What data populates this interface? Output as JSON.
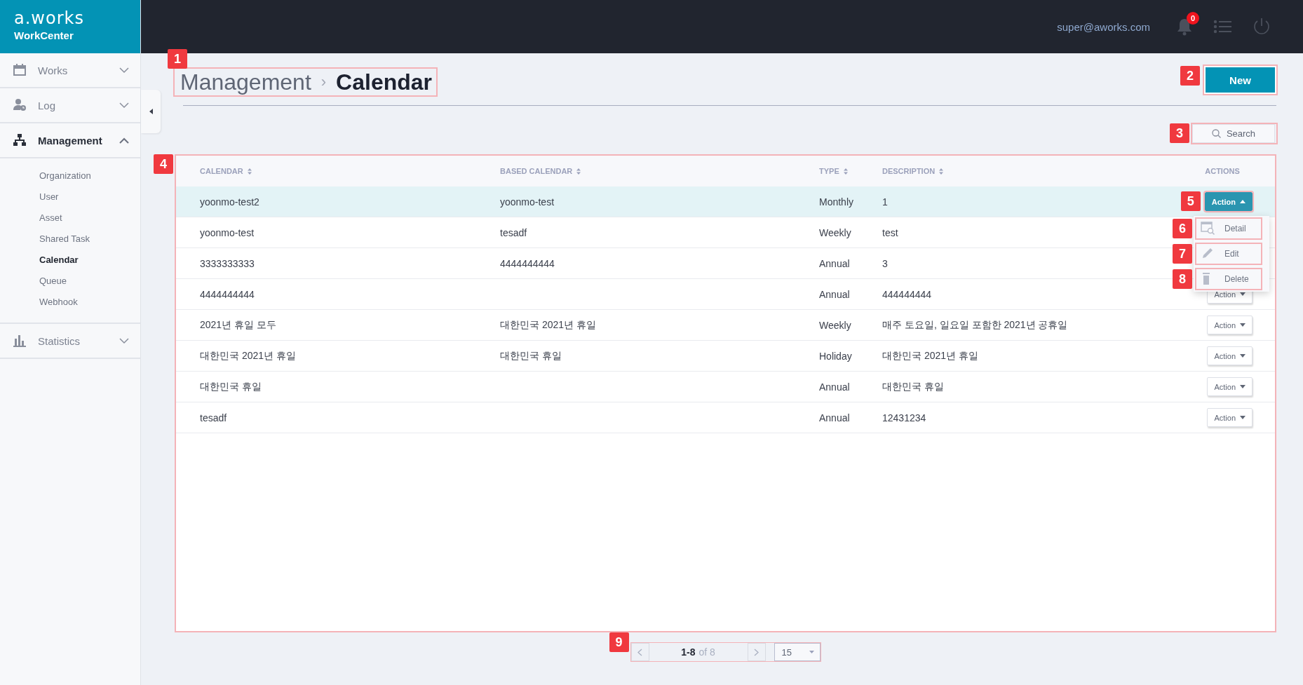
{
  "brand": {
    "logo": "a.works",
    "product": "WorkCenter"
  },
  "topbar": {
    "user": "super@aworks.com",
    "notifications": "0"
  },
  "sidebar": {
    "items": [
      {
        "label": "Works",
        "kind": "calendar",
        "expanded": false
      },
      {
        "label": "Log",
        "kind": "user-clock",
        "expanded": false
      },
      {
        "label": "Management",
        "kind": "sitemap",
        "expanded": true,
        "children": [
          {
            "label": "Organization",
            "selected": false
          },
          {
            "label": "User",
            "selected": false
          },
          {
            "label": "Asset",
            "selected": false
          },
          {
            "label": "Shared Task",
            "selected": false
          },
          {
            "label": "Calendar",
            "selected": true
          },
          {
            "label": "Queue",
            "selected": false
          },
          {
            "label": "Webhook",
            "selected": false
          }
        ]
      },
      {
        "label": "Statistics",
        "kind": "bar-chart",
        "expanded": false
      }
    ]
  },
  "breadcrumb": {
    "parent": "Management",
    "separator": "›",
    "current": "Calendar",
    "callout": "1"
  },
  "new_button": {
    "label": "New",
    "callout": "2"
  },
  "search_button": {
    "label": "Search",
    "callout": "3"
  },
  "table": {
    "callout": "4",
    "columns": [
      {
        "label": "CALENDAR",
        "sortable": true
      },
      {
        "label": "BASED CALENDAR",
        "sortable": true
      },
      {
        "label": "TYPE",
        "sortable": true
      },
      {
        "label": "DESCRIPTION",
        "sortable": true
      },
      {
        "label": "ACTIONS",
        "sortable": false
      }
    ],
    "rows": [
      {
        "cells": [
          "yoonmo-test2",
          "yoonmo-test",
          "Monthly",
          "1"
        ],
        "selected": true,
        "action": "Action",
        "expanded": true,
        "callout": "5"
      },
      {
        "cells": [
          "yoonmo-test",
          "tesadf",
          "Weekly",
          "test"
        ],
        "selected": false
      },
      {
        "cells": [
          "3333333333",
          "4444444444",
          "Annual",
          "3"
        ],
        "selected": false
      },
      {
        "cells": [
          "4444444444",
          "",
          "Annual",
          "444444444"
        ],
        "selected": false,
        "action": "Action",
        "expanded": false
      },
      {
        "cells": [
          "2021년 휴일 모두",
          "대한민국 2021년 휴일",
          "Weekly",
          "매주 토요일, 일요일 포함한 2021년 공휴일"
        ],
        "selected": false,
        "action": "Action",
        "expanded": false
      },
      {
        "cells": [
          "대한민국 2021년 휴일",
          "대한민국 휴일",
          "Holiday",
          "대한민국 2021년 휴일"
        ],
        "selected": false,
        "action": "Action",
        "expanded": false
      },
      {
        "cells": [
          "대한민국 휴일",
          "",
          "Annual",
          "대한민국 휴일"
        ],
        "selected": false,
        "action": "Action",
        "expanded": false
      },
      {
        "cells": [
          "tesadf",
          "",
          "Annual",
          "12431234"
        ],
        "selected": false,
        "action": "Action",
        "expanded": false
      }
    ]
  },
  "action_menu": {
    "items": [
      {
        "label": "Detail",
        "kind": "detail",
        "callout": "6"
      },
      {
        "label": "Edit",
        "kind": "edit",
        "callout": "7"
      },
      {
        "label": "Delete",
        "kind": "delete",
        "callout": "8"
      }
    ]
  },
  "pagination": {
    "range": "1-8",
    "total": "of 8",
    "page_size": "15",
    "callout": "9"
  }
}
